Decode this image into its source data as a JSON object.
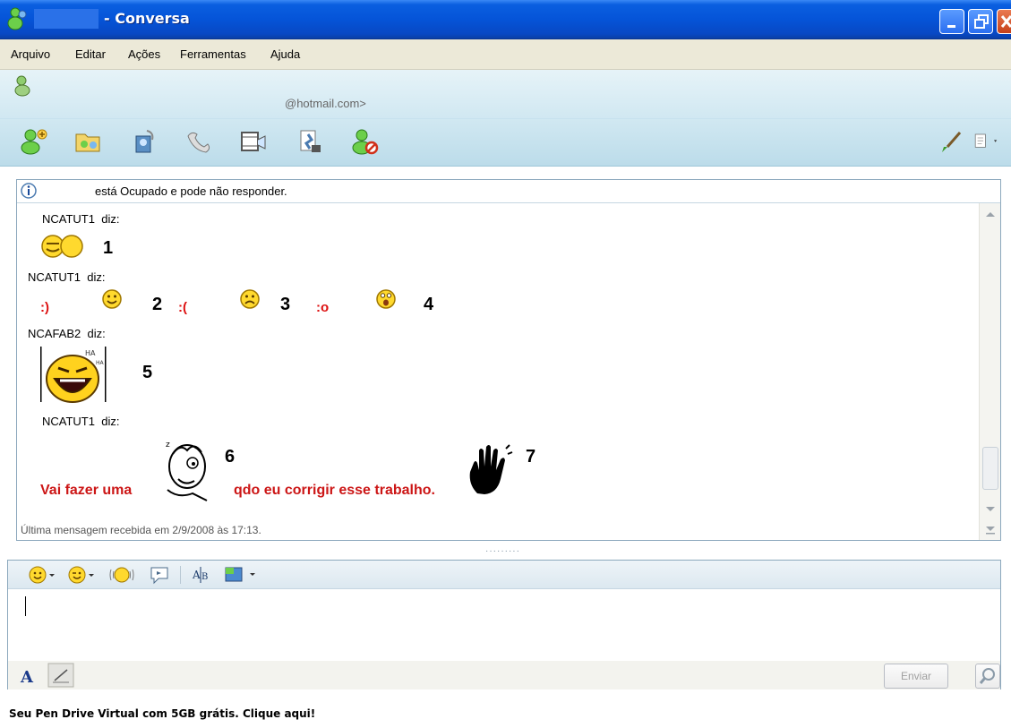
{
  "window": {
    "title": "- Conversa"
  },
  "menu": [
    {
      "label": "Arquivo"
    },
    {
      "label": "Editar"
    },
    {
      "label": "Ações"
    },
    {
      "label": "Ferramentas"
    },
    {
      "label": "Ajuda"
    }
  ],
  "contact": {
    "email": "@hotmail.com>"
  },
  "toolbar": {
    "icons": [
      "invite-contact-icon",
      "send-files-icon",
      "webcam-icon",
      "call-icon",
      "video-icon",
      "activities-icon",
      "block-icon",
      "paint-brush-icon",
      "show-menu-icon"
    ]
  },
  "conversation": {
    "notice": "está Ocupado e pode não responder.",
    "messages": [
      {
        "sender": "NCATUT1",
        "says": "diz:",
        "label": "1"
      },
      {
        "sender": "NCATUT1",
        "says": "diz:",
        "items": [
          {
            "code": ":)",
            "label": "2"
          },
          {
            "code": ":(",
            "label": "3"
          },
          {
            "code": ":o",
            "label": "4"
          }
        ]
      },
      {
        "sender": "NCAFAB2",
        "says": "diz:",
        "label": "5"
      },
      {
        "sender": "NCATUT1",
        "says": "diz:",
        "text_before": "Vai fazer uma",
        "label_wink": "6",
        "text_after": "qdo eu corrigir esse trabalho.",
        "label_hand": "7"
      }
    ],
    "last_message": "Última mensagem recebida em 2/9/2008 às 17:13."
  },
  "input": {
    "send_label": "Enviar",
    "format_icons": [
      "emoticon-icon",
      "wink-icon",
      "nudge-icon",
      "voice-clip-icon",
      "font-icon",
      "background-icon"
    ]
  },
  "ad": {
    "text": "Seu Pen Drive Virtual com 5GB grátis. Clique aqui!"
  }
}
